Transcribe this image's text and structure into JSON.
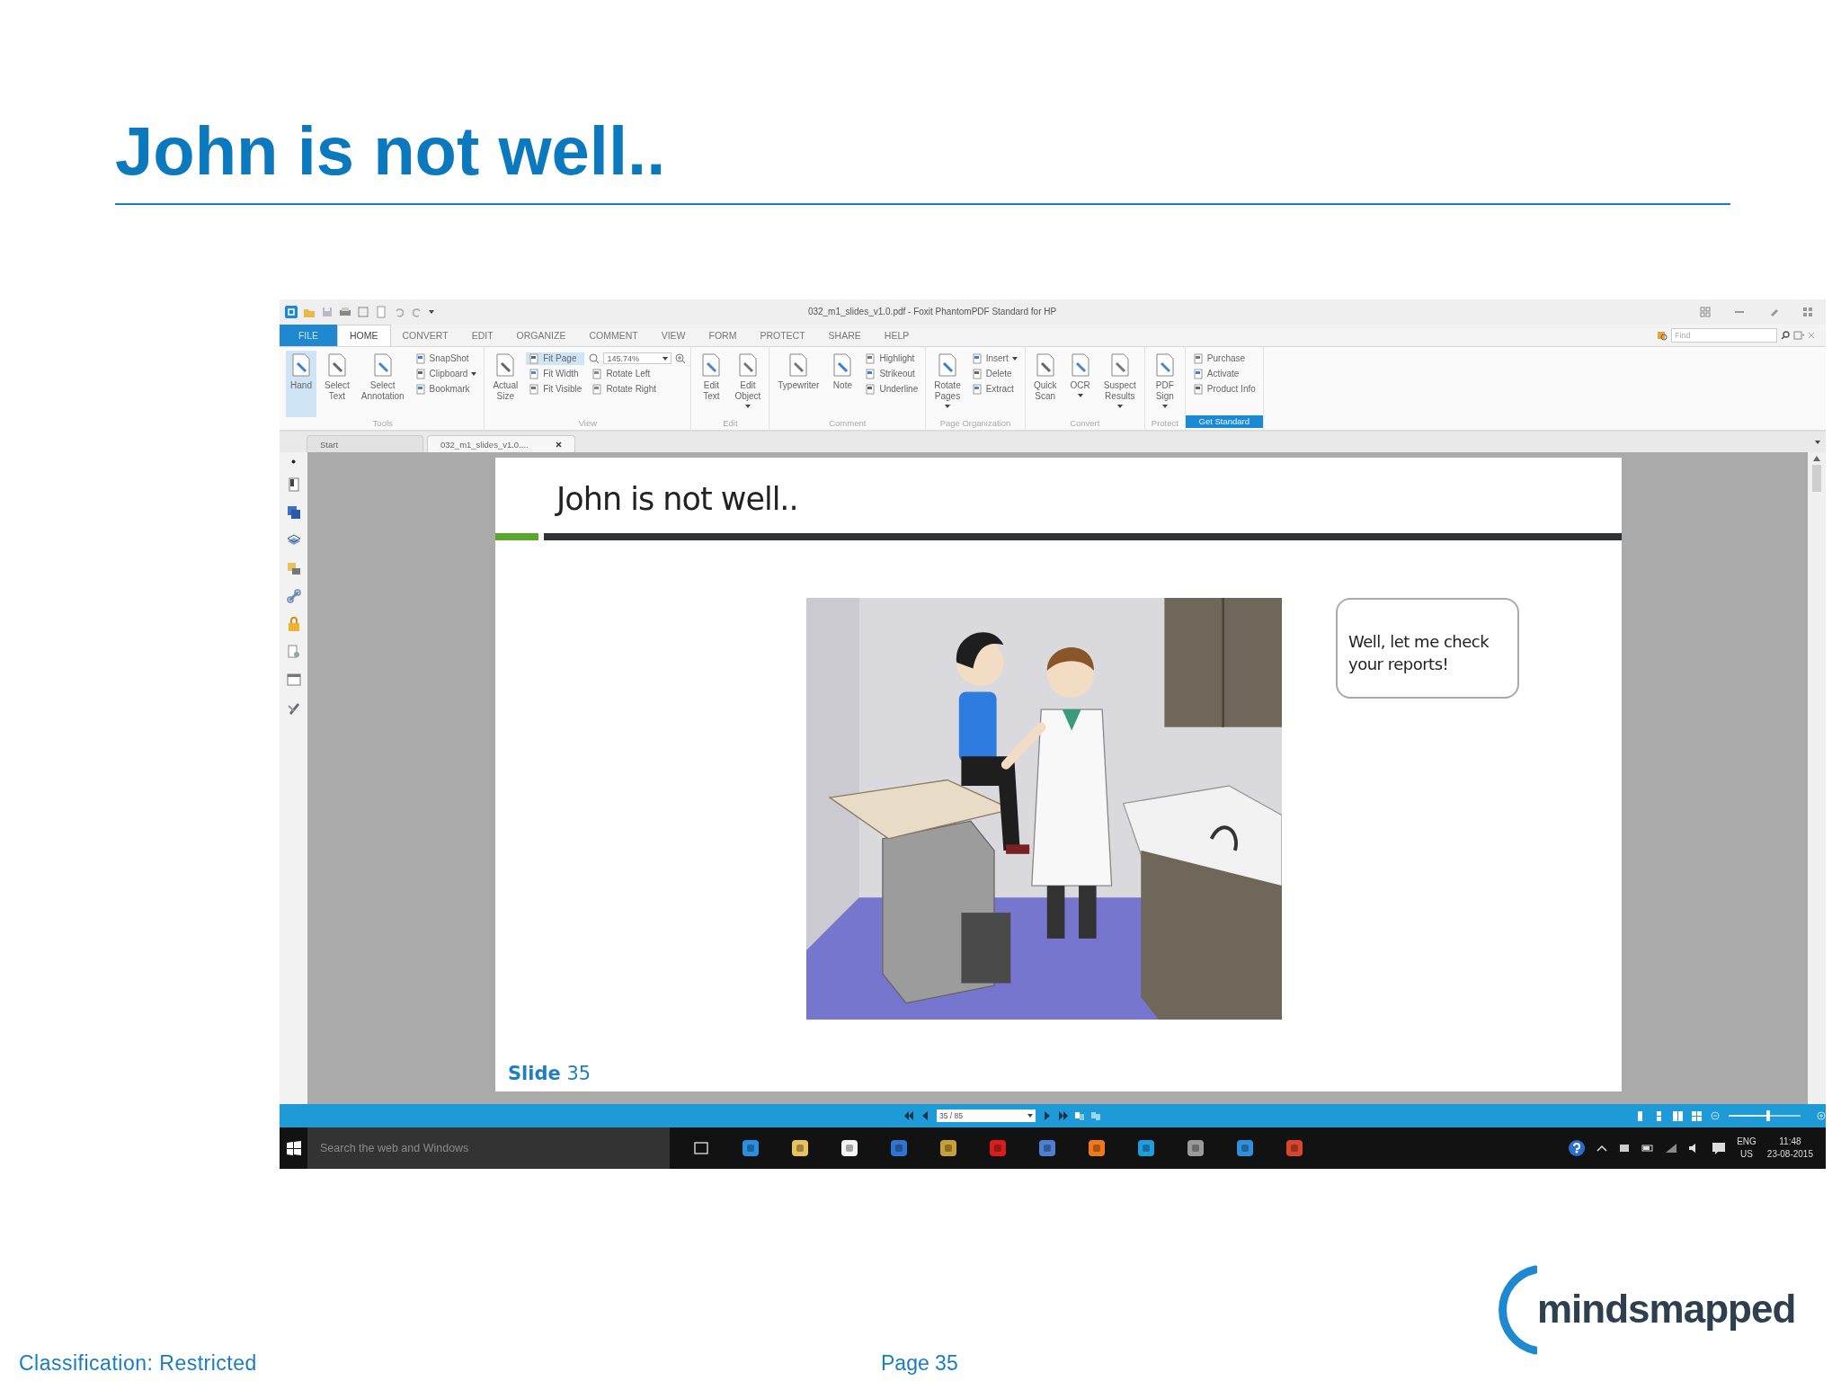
{
  "slide": {
    "title": "John is not well..",
    "classification": "Classification: Restricted",
    "page": "Page 35",
    "logo": "mindsmapped"
  },
  "app": {
    "window_title": "032_m1_slides_v1.0.pdf - Foxit PhantomPDF Standard for HP",
    "menu_tabs": [
      {
        "label": "FILE",
        "kind": "file",
        "selected": false
      },
      {
        "label": "HOME",
        "kind": "tab",
        "selected": true
      },
      {
        "label": "CONVERT",
        "kind": "tab",
        "selected": false
      },
      {
        "label": "EDIT",
        "kind": "tab",
        "selected": false
      },
      {
        "label": "ORGANIZE",
        "kind": "tab",
        "selected": false
      },
      {
        "label": "COMMENT",
        "kind": "tab",
        "selected": false
      },
      {
        "label": "VIEW",
        "kind": "tab",
        "selected": false
      },
      {
        "label": "FORM",
        "kind": "tab",
        "selected": false
      },
      {
        "label": "PROTECT",
        "kind": "tab",
        "selected": false
      },
      {
        "label": "SHARE",
        "kind": "tab",
        "selected": false
      },
      {
        "label": "HELP",
        "kind": "tab",
        "selected": false
      }
    ],
    "find": {
      "placeholder": "Find"
    },
    "ribbon": [
      {
        "label": "Tools",
        "kind": "caption",
        "columns": [
          {
            "kind": "large",
            "label": "Hand",
            "selected": true
          },
          {
            "kind": "large",
            "label": "Select Text",
            "selected": false
          },
          {
            "kind": "large",
            "label": "Select Annotation",
            "selected": false
          },
          {
            "kind": "stack",
            "items": [
              {
                "label": "SnapShot",
                "selected": false
              },
              {
                "label": "Clipboard",
                "selected": false,
                "dropdown": true
              },
              {
                "label": "Bookmark",
                "selected": false
              }
            ]
          }
        ]
      },
      {
        "label": "View",
        "kind": "caption",
        "columns": [
          {
            "kind": "large",
            "label": "Actual Size",
            "selected": false
          },
          {
            "kind": "stack",
            "items": [
              {
                "label": "Fit Page",
                "selected": true
              },
              {
                "label": "Fit Width",
                "selected": false
              },
              {
                "label": "Fit Visible",
                "selected": false
              }
            ]
          },
          {
            "kind": "zoom",
            "value": "145.74%",
            "items": [
              {
                "label": "Rotate Left",
                "selected": false
              },
              {
                "label": "Rotate Right",
                "selected": false
              }
            ]
          }
        ]
      },
      {
        "label": "Edit",
        "kind": "caption",
        "columns": [
          {
            "kind": "large",
            "label": "Edit Text",
            "selected": false
          },
          {
            "kind": "large",
            "label": "Edit Object",
            "selected": false,
            "dropdown": true
          }
        ]
      },
      {
        "label": "Comment",
        "kind": "caption",
        "columns": [
          {
            "kind": "large",
            "label": "Typewriter",
            "selected": false
          },
          {
            "kind": "large",
            "label": "Note",
            "selected": false
          },
          {
            "kind": "stack",
            "items": [
              {
                "label": "Highlight",
                "selected": false
              },
              {
                "label": "Strikeout",
                "selected": false
              },
              {
                "label": "Underline",
                "selected": false
              }
            ]
          }
        ]
      },
      {
        "label": "Page Organization",
        "kind": "caption",
        "columns": [
          {
            "kind": "large",
            "label": "Rotate Pages",
            "selected": false,
            "dropdown": true
          },
          {
            "kind": "stack",
            "items": [
              {
                "label": "Insert",
                "selected": false,
                "dropdown": true
              },
              {
                "label": "Delete",
                "selected": false
              },
              {
                "label": "Extract",
                "selected": false
              }
            ]
          }
        ]
      },
      {
        "label": "Convert",
        "kind": "caption",
        "columns": [
          {
            "kind": "large",
            "label": "Quick Scan",
            "selected": false
          },
          {
            "kind": "large",
            "label": "OCR",
            "selected": false,
            "dropdown": true
          },
          {
            "kind": "large",
            "label": "Suspect Results",
            "selected": false,
            "dropdown": true
          }
        ]
      },
      {
        "label": "Protect",
        "kind": "caption",
        "columns": [
          {
            "kind": "large",
            "label": "PDF Sign",
            "selected": false,
            "dropdown": true
          }
        ]
      },
      {
        "label": "Get Standard",
        "kind": "button",
        "columns": [
          {
            "kind": "stack",
            "items": [
              {
                "label": "Purchase",
                "selected": false
              },
              {
                "label": "Activate",
                "selected": false
              },
              {
                "label": "Product Info",
                "selected": false
              }
            ]
          }
        ]
      }
    ],
    "doc_tabs": [
      {
        "label": "Start",
        "selected": false,
        "closable": false
      },
      {
        "label": "032_m1_slides_v1.0....",
        "selected": true,
        "closable": true
      }
    ],
    "document": {
      "title": "John is not well..",
      "bubble": "Well, let me check your reports!",
      "slide_label": "**Slide** 35"
    },
    "status": {
      "page": "35 / 85",
      "zoom_slider": {
        "level": 0.55
      }
    },
    "taskbar": {
      "search_placeholder": "Search the web and Windows",
      "language": "ENG",
      "region": "US",
      "time": "11:48",
      "date": "23-08-2015"
    }
  }
}
